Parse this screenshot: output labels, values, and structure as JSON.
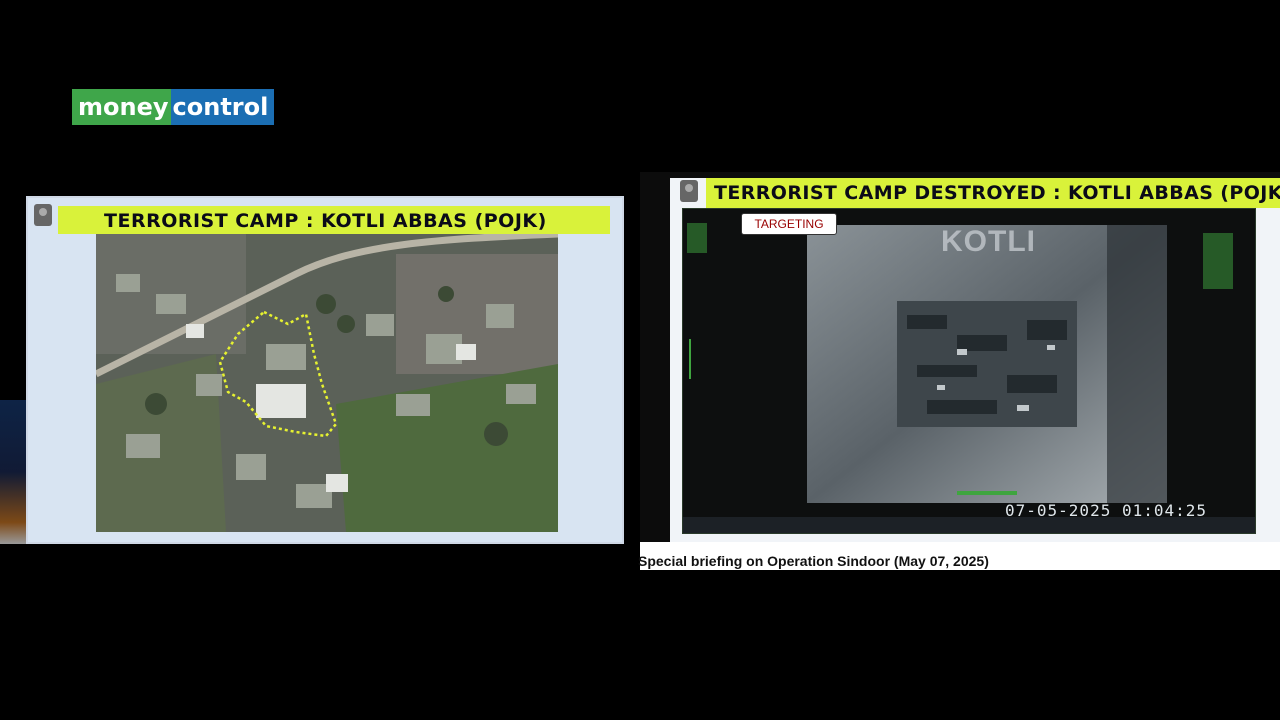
{
  "logo": {
    "part1": "money",
    "part2": "control",
    "colors": {
      "green": "#3fa64a",
      "blue": "#1b6eb3"
    }
  },
  "left_slide": {
    "title": "TERRORIST CAMP : KOTLI ABBAS (POJK)"
  },
  "right_slide": {
    "title": "TERRORIST CAMP DESTROYED : KOTLI ABBAS (POJK)",
    "targeting_label": "TARGETING",
    "overlay_label": "KOTLI",
    "timestamp": "07-05-2025 01:04:25"
  },
  "caption": "Special briefing on Operation Sindoor (May 07, 2025)",
  "colors": {
    "banner": "#d9f23a",
    "boundary": "#e6f230"
  }
}
